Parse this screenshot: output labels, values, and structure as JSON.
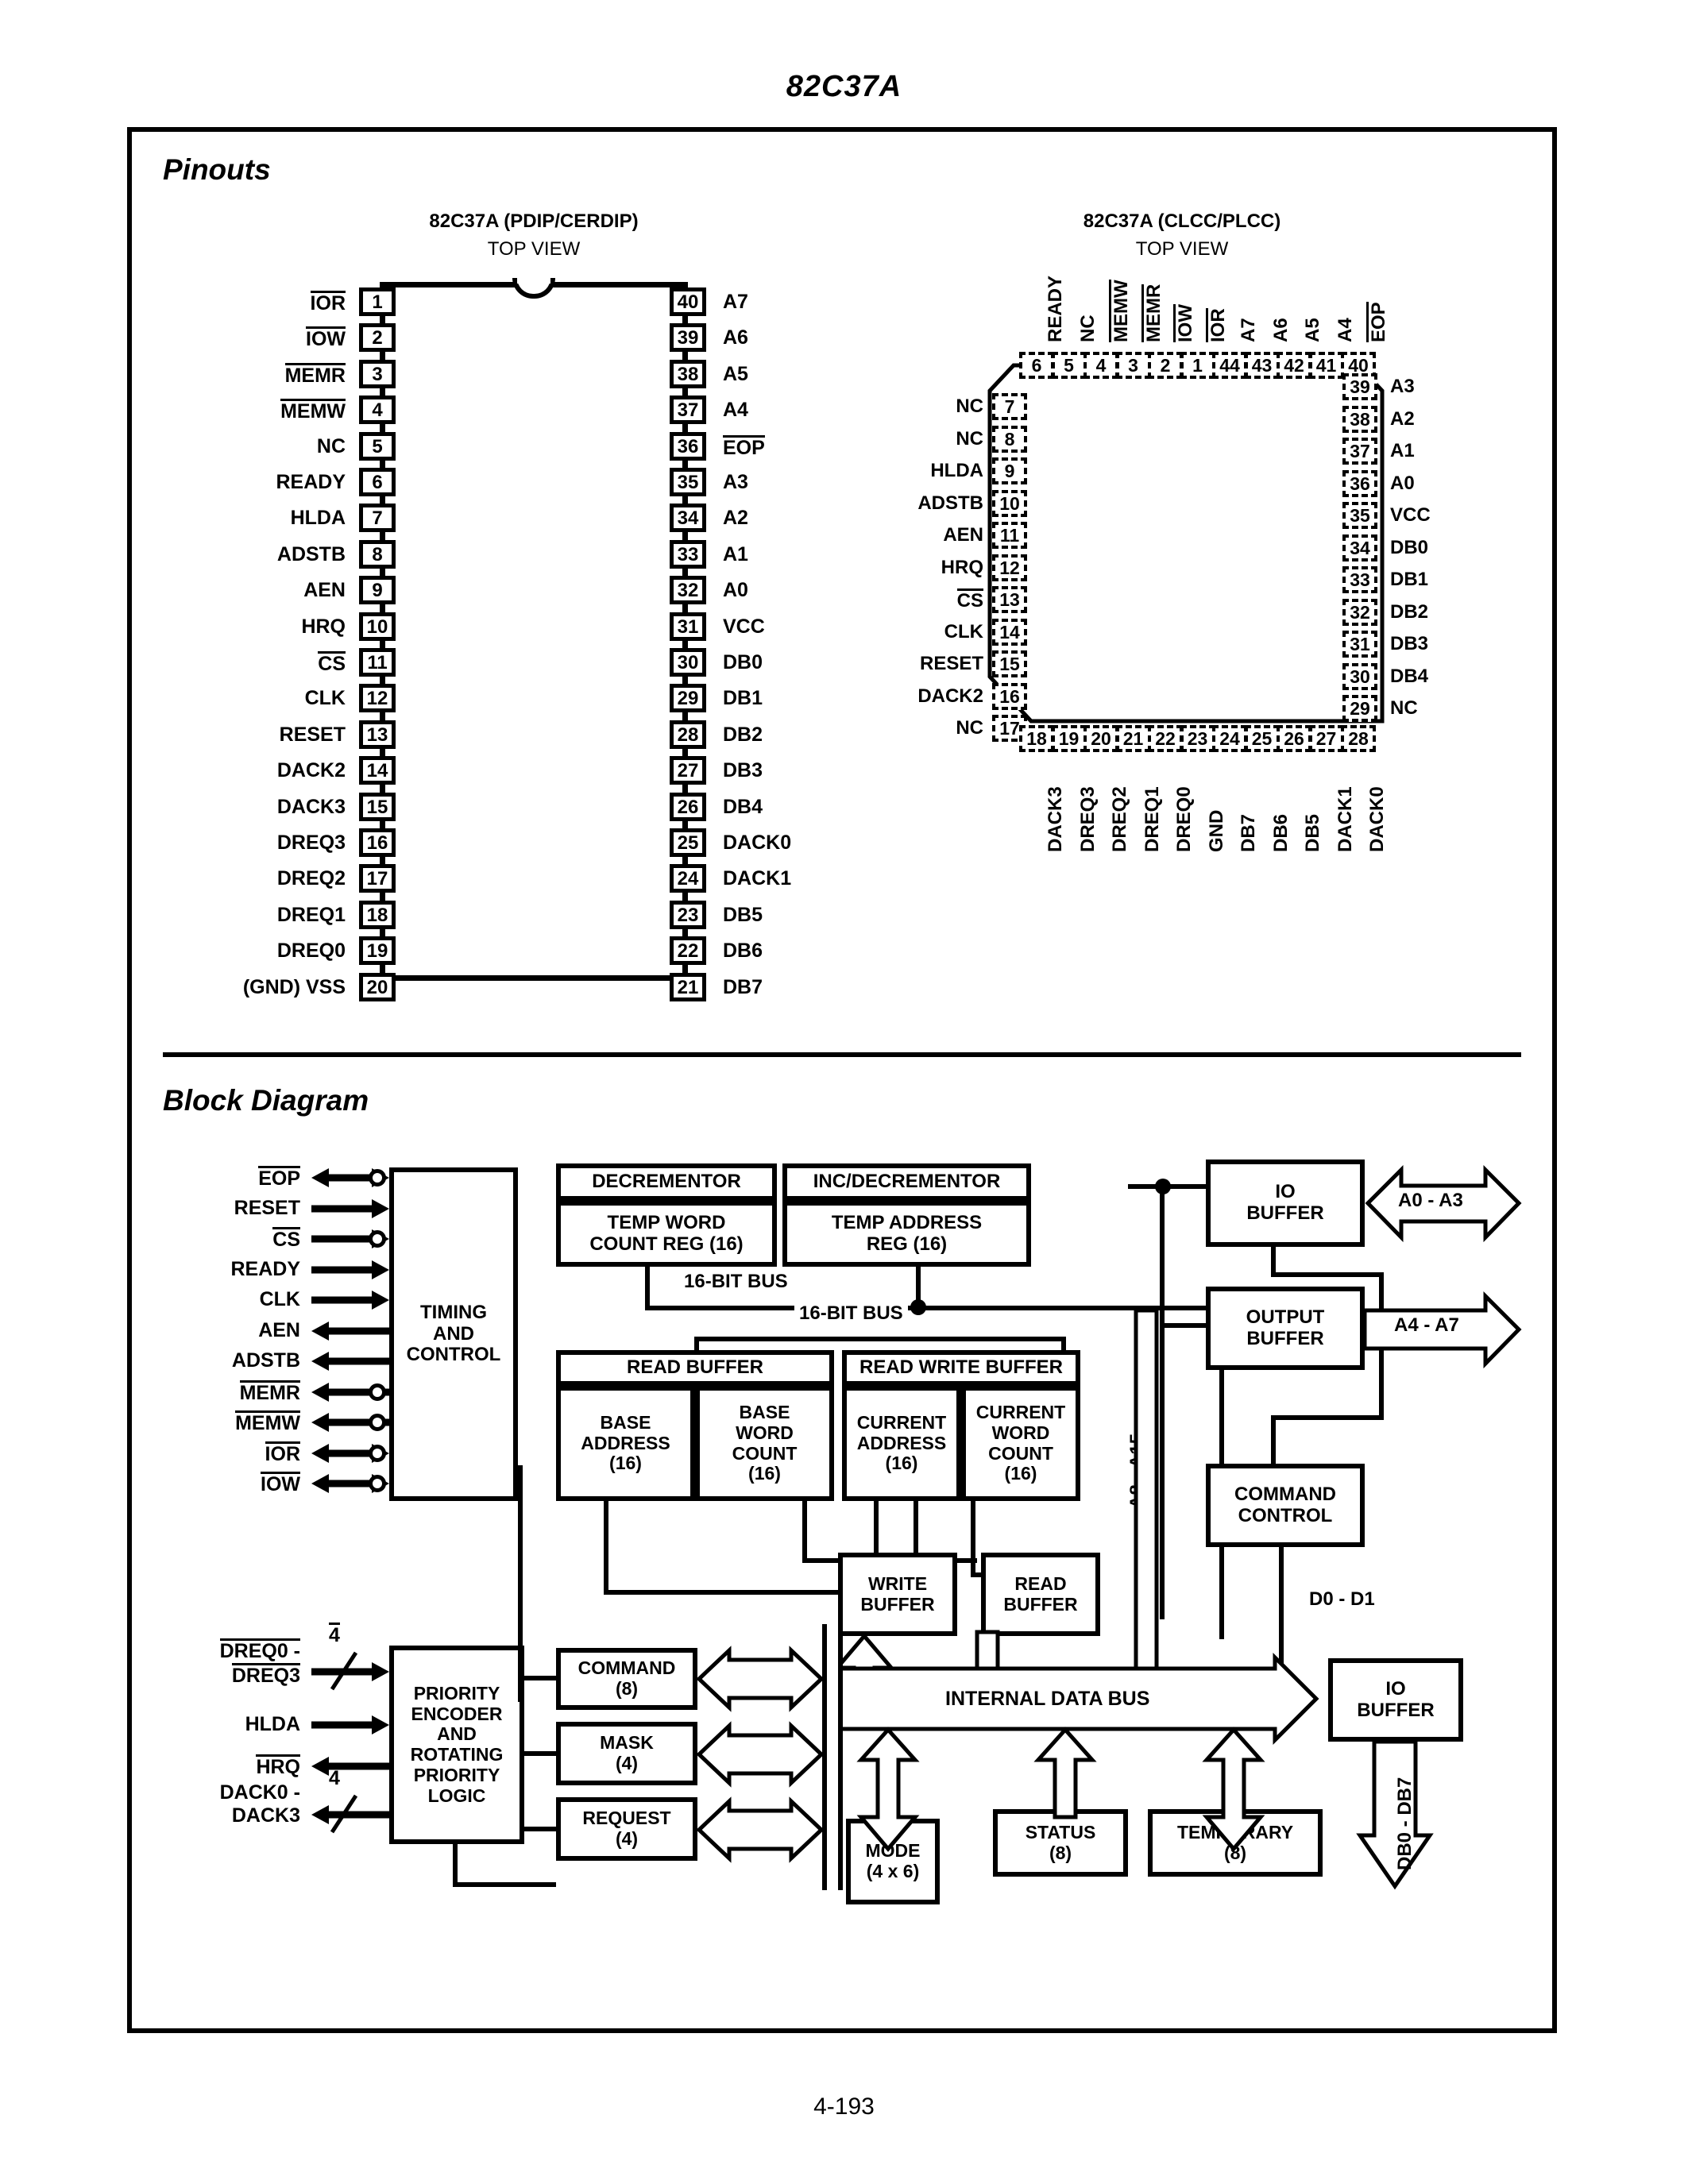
{
  "page": {
    "title": "82C37A",
    "footer": "4-193",
    "section_pinouts": "Pinouts",
    "section_block_diagram": "Block Diagram"
  },
  "dip": {
    "title": "82C37A (PDIP/CERDIP)",
    "subtitle": "TOP VIEW",
    "left_pins": [
      {
        "n": "1",
        "label": "IOR",
        "bar": true
      },
      {
        "n": "2",
        "label": "IOW",
        "bar": true
      },
      {
        "n": "3",
        "label": "MEMR",
        "bar": true
      },
      {
        "n": "4",
        "label": "MEMW",
        "bar": true
      },
      {
        "n": "5",
        "label": "NC",
        "bar": false
      },
      {
        "n": "6",
        "label": "READY",
        "bar": false
      },
      {
        "n": "7",
        "label": "HLDA",
        "bar": false
      },
      {
        "n": "8",
        "label": "ADSTB",
        "bar": false
      },
      {
        "n": "9",
        "label": "AEN",
        "bar": false
      },
      {
        "n": "10",
        "label": "HRQ",
        "bar": false
      },
      {
        "n": "11",
        "label": "CS",
        "bar": true
      },
      {
        "n": "12",
        "label": "CLK",
        "bar": false
      },
      {
        "n": "13",
        "label": "RESET",
        "bar": false
      },
      {
        "n": "14",
        "label": "DACK2",
        "bar": false
      },
      {
        "n": "15",
        "label": "DACK3",
        "bar": false
      },
      {
        "n": "16",
        "label": "DREQ3",
        "bar": false
      },
      {
        "n": "17",
        "label": "DREQ2",
        "bar": false
      },
      {
        "n": "18",
        "label": "DREQ1",
        "bar": false
      },
      {
        "n": "19",
        "label": "DREQ0",
        "bar": false
      },
      {
        "n": "20",
        "label": "(GND) VSS",
        "bar": false
      }
    ],
    "right_pins": [
      {
        "n": "40",
        "label": "A7",
        "bar": false
      },
      {
        "n": "39",
        "label": "A6",
        "bar": false
      },
      {
        "n": "38",
        "label": "A5",
        "bar": false
      },
      {
        "n": "37",
        "label": "A4",
        "bar": false
      },
      {
        "n": "36",
        "label": "EOP",
        "bar": true
      },
      {
        "n": "35",
        "label": "A3",
        "bar": false
      },
      {
        "n": "34",
        "label": "A2",
        "bar": false
      },
      {
        "n": "33",
        "label": "A1",
        "bar": false
      },
      {
        "n": "32",
        "label": "A0",
        "bar": false
      },
      {
        "n": "31",
        "label": "VCC",
        "bar": false
      },
      {
        "n": "30",
        "label": "DB0",
        "bar": false
      },
      {
        "n": "29",
        "label": "DB1",
        "bar": false
      },
      {
        "n": "28",
        "label": "DB2",
        "bar": false
      },
      {
        "n": "27",
        "label": "DB3",
        "bar": false
      },
      {
        "n": "26",
        "label": "DB4",
        "bar": false
      },
      {
        "n": "25",
        "label": "DACK0",
        "bar": false
      },
      {
        "n": "24",
        "label": "DACK1",
        "bar": false
      },
      {
        "n": "23",
        "label": "DB5",
        "bar": false
      },
      {
        "n": "22",
        "label": "DB6",
        "bar": false
      },
      {
        "n": "21",
        "label": "DB7",
        "bar": false
      }
    ]
  },
  "plcc": {
    "title": "82C37A (CLCC/PLCC)",
    "subtitle": "TOP VIEW",
    "top_pins": [
      {
        "n": "6",
        "label": "READY",
        "bar": false
      },
      {
        "n": "5",
        "label": "NC",
        "bar": false
      },
      {
        "n": "4",
        "label": "MEMW",
        "bar": true
      },
      {
        "n": "3",
        "label": "MEMR",
        "bar": true
      },
      {
        "n": "2",
        "label": "IOW",
        "bar": true
      },
      {
        "n": "1",
        "label": "IOR",
        "bar": true
      },
      {
        "n": "44",
        "label": "A7",
        "bar": false
      },
      {
        "n": "43",
        "label": "A6",
        "bar": false
      },
      {
        "n": "42",
        "label": "A5",
        "bar": false
      },
      {
        "n": "41",
        "label": "A4",
        "bar": false
      },
      {
        "n": "40",
        "label": "EOP",
        "bar": true
      }
    ],
    "left_pins": [
      {
        "n": "7",
        "label": "NC",
        "bar": false
      },
      {
        "n": "8",
        "label": "NC",
        "bar": false
      },
      {
        "n": "9",
        "label": "HLDA",
        "bar": false
      },
      {
        "n": "10",
        "label": "ADSTB",
        "bar": false
      },
      {
        "n": "11",
        "label": "AEN",
        "bar": false
      },
      {
        "n": "12",
        "label": "HRQ",
        "bar": false
      },
      {
        "n": "13",
        "label": "CS",
        "bar": true
      },
      {
        "n": "14",
        "label": "CLK",
        "bar": false
      },
      {
        "n": "15",
        "label": "RESET",
        "bar": false
      },
      {
        "n": "16",
        "label": "DACK2",
        "bar": false
      },
      {
        "n": "17",
        "label": "NC",
        "bar": false
      }
    ],
    "bottom_pins": [
      {
        "n": "18",
        "label": "DACK3",
        "bar": false
      },
      {
        "n": "19",
        "label": "DREQ3",
        "bar": false
      },
      {
        "n": "20",
        "label": "DREQ2",
        "bar": false
      },
      {
        "n": "21",
        "label": "DREQ1",
        "bar": false
      },
      {
        "n": "22",
        "label": "DREQ0",
        "bar": false
      },
      {
        "n": "23",
        "label": "GND",
        "bar": false
      },
      {
        "n": "24",
        "label": "DB7",
        "bar": false
      },
      {
        "n": "25",
        "label": "DB6",
        "bar": false
      },
      {
        "n": "26",
        "label": "DB5",
        "bar": false
      },
      {
        "n": "27",
        "label": "DACK1",
        "bar": false
      },
      {
        "n": "28",
        "label": "DACK0",
        "bar": false
      }
    ],
    "right_pins": [
      {
        "n": "39",
        "label": "A3",
        "bar": false
      },
      {
        "n": "38",
        "label": "A2",
        "bar": false
      },
      {
        "n": "37",
        "label": "A1",
        "bar": false
      },
      {
        "n": "36",
        "label": "A0",
        "bar": false
      },
      {
        "n": "35",
        "label": "VCC",
        "bar": false
      },
      {
        "n": "34",
        "label": "DB0",
        "bar": false
      },
      {
        "n": "33",
        "label": "DB1",
        "bar": false
      },
      {
        "n": "32",
        "label": "DB2",
        "bar": false
      },
      {
        "n": "31",
        "label": "DB3",
        "bar": false
      },
      {
        "n": "30",
        "label": "DB4",
        "bar": false
      },
      {
        "n": "29",
        "label": "NC",
        "bar": false
      }
    ]
  },
  "block_diagram": {
    "control_signals": [
      {
        "label": "EOP",
        "bar": true,
        "dir": "bidir",
        "bubble": true
      },
      {
        "label": "RESET",
        "bar": false,
        "dir": "in",
        "bubble": false
      },
      {
        "label": "CS",
        "bar": true,
        "dir": "in",
        "bubble": true
      },
      {
        "label": "READY",
        "bar": false,
        "dir": "in",
        "bubble": false
      },
      {
        "label": "CLK",
        "bar": false,
        "dir": "in",
        "bubble": false
      },
      {
        "label": "AEN",
        "bar": false,
        "dir": "out",
        "bubble": false
      },
      {
        "label": "ADSTB",
        "bar": false,
        "dir": "out",
        "bubble": false
      },
      {
        "label": "MEMR",
        "bar": true,
        "dir": "out",
        "bubble": true
      },
      {
        "label": "MEMW",
        "bar": true,
        "dir": "out",
        "bubble": true
      },
      {
        "label": "IOR",
        "bar": true,
        "dir": "bidir",
        "bubble": true
      },
      {
        "label": "IOW",
        "bar": true,
        "dir": "bidir",
        "bubble": true
      }
    ],
    "priority_signals": [
      {
        "label_top": "DREQ0 -",
        "label_bot": "DREQ3",
        "bar": true,
        "dir": "in",
        "bus": "4"
      },
      {
        "label_top": "HLDA",
        "label_bot": "",
        "bar": false,
        "dir": "in",
        "bus": ""
      },
      {
        "label_top": "HRQ",
        "label_bot": "",
        "bar": true,
        "dir": "out",
        "bus": ""
      },
      {
        "label_top": "DACK0 -",
        "label_bot": "DACK3",
        "bar": false,
        "dir": "out",
        "bus": "4"
      }
    ],
    "blocks": {
      "timing_control": [
        "TIMING",
        "AND",
        "CONTROL"
      ],
      "decrementor": "DECREMENTOR",
      "temp_word_count": [
        "TEMP WORD",
        "COUNT REG (16)"
      ],
      "inc_decrementor": "INC/DECREMENTOR",
      "temp_address": [
        "TEMP ADDRESS",
        "REG (16)"
      ],
      "read_buffer_hdr": "READ BUFFER",
      "base_address": [
        "BASE",
        "ADDRESS",
        "(16)"
      ],
      "base_word_count": [
        "BASE",
        "WORD",
        "COUNT",
        "(16)"
      ],
      "read_write_buffer_hdr": "READ WRITE BUFFER",
      "current_address": [
        "CURRENT",
        "ADDRESS",
        "(16)"
      ],
      "current_word_count": [
        "CURRENT",
        "WORD",
        "COUNT",
        "(16)"
      ],
      "write_buffer": [
        "WRITE",
        "BUFFER"
      ],
      "read_buffer": [
        "READ",
        "BUFFER"
      ],
      "io_buffer_top": [
        "IO",
        "BUFFER"
      ],
      "output_buffer": [
        "OUTPUT",
        "BUFFER"
      ],
      "command_control": [
        "COMMAND",
        "CONTROL"
      ],
      "io_buffer_bottom": [
        "IO",
        "BUFFER"
      ],
      "priority_encoder": [
        "PRIORITY",
        "ENCODER",
        "AND",
        "ROTATING",
        "PRIORITY",
        "LOGIC"
      ],
      "command": [
        "COMMAND",
        "(8)"
      ],
      "mask": [
        "MASK",
        "(4)"
      ],
      "request": [
        "REQUEST",
        "(4)"
      ],
      "mode": [
        "MODE",
        "(4 x 6)"
      ],
      "status": [
        "STATUS",
        "(8)"
      ],
      "temporary": [
        "TEMPORARY",
        "(8)"
      ]
    },
    "bus_labels": {
      "bit16_upper": "16-BIT BUS",
      "bit16_lower": "16-BIT BUS",
      "internal_data_bus": "INTERNAL DATA BUS",
      "a8_a15": "A8 - A15",
      "a0_a3": "A0 - A3",
      "a4_a7": "A4 - A7",
      "d0_d1": "D0 - D1",
      "db0_db7": "DB0 - DB7"
    }
  }
}
